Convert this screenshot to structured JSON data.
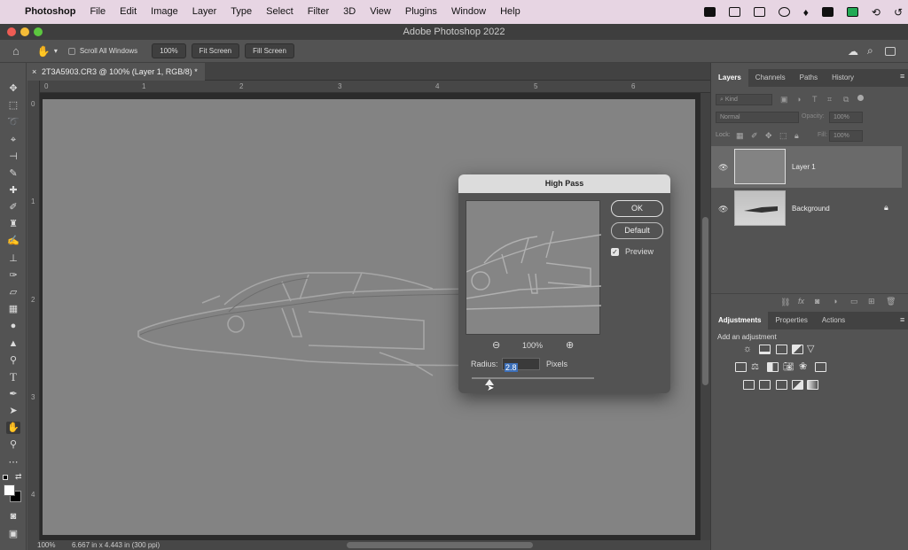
{
  "menubar": {
    "app_name": "Photoshop",
    "items": [
      "File",
      "Edit",
      "Image",
      "Layer",
      "Type",
      "Select",
      "Filter",
      "3D",
      "View",
      "Plugins",
      "Window",
      "Help"
    ]
  },
  "window": {
    "title": "Adobe Photoshop 2022"
  },
  "options_bar": {
    "scroll_all_windows": "Scroll All Windows",
    "zoom": "100%",
    "fit_screen": "Fit Screen",
    "fill_screen": "Fill Screen"
  },
  "document": {
    "tab_title": "2T3A5903.CR3 @ 100% (Layer 1, RGB/8) *",
    "zoom": "100%",
    "doc_info": "6.667 in x 4.443 in (300 ppi)"
  },
  "rulers": {
    "h": [
      "0",
      "1",
      "2",
      "3",
      "4",
      "5",
      "6"
    ],
    "v": [
      "0",
      "1",
      "2",
      "3",
      "4"
    ]
  },
  "layers_panel": {
    "tabs": [
      "Layers",
      "Channels",
      "Paths",
      "History"
    ],
    "active_tab": "Layers",
    "kind_label": "Kind",
    "blend_mode": "Normal",
    "opacity_label": "Opacity:",
    "opacity_value": "100%",
    "lock_label": "Lock:",
    "fill_label": "Fill:",
    "fill_value": "100%",
    "layers": [
      {
        "name": "Layer 1",
        "selected": true
      },
      {
        "name": "Background",
        "locked": true
      }
    ]
  },
  "adjustments_panel": {
    "tabs": [
      "Adjustments",
      "Properties",
      "Actions"
    ],
    "active_tab": "Adjustments",
    "hint": "Add an adjustment"
  },
  "high_pass_dialog": {
    "title": "High Pass",
    "ok": "OK",
    "default": "Default",
    "preview_label": "Preview",
    "preview_checked": true,
    "zoom": "100%",
    "radius_label": "Radius:",
    "radius_value": "2.8",
    "units": "Pixels"
  },
  "colors": {
    "menubar_bg": "#e7d5e3",
    "panel_bg": "#535353",
    "canvas_gray": "#838383",
    "highlight_blue": "#3c6fb8"
  }
}
